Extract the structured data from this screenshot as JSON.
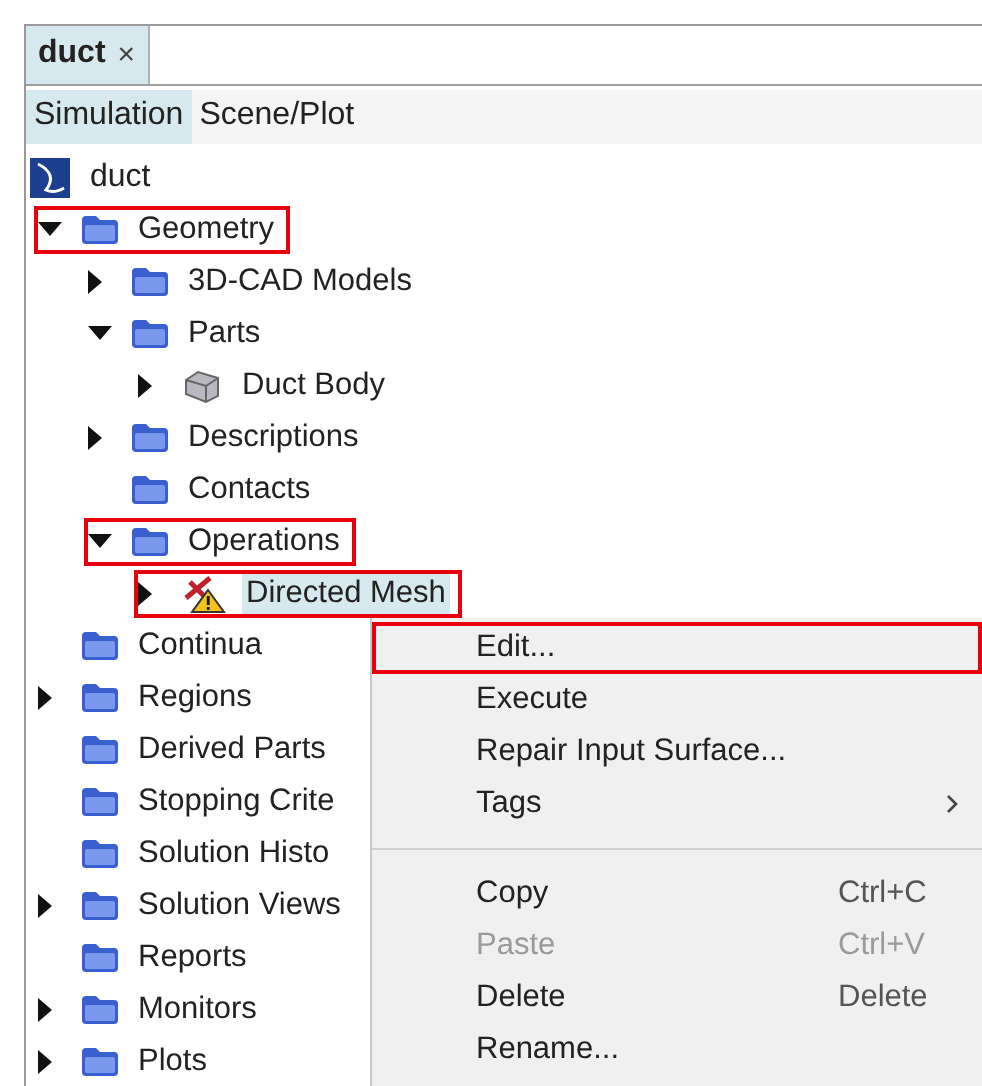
{
  "tab": {
    "title": "duct",
    "close": "×",
    "selected": true
  },
  "view_tabs": [
    {
      "label": "Simulation",
      "selected": true
    },
    {
      "label": "Scene/Plot",
      "selected": false
    }
  ],
  "tree": {
    "root": {
      "label": "duct",
      "kind": "root"
    },
    "items": [
      {
        "label": "Geometry",
        "kind": "folder",
        "expandable": true,
        "expanded": true,
        "highlighted": true,
        "selected": false,
        "children": [
          {
            "label": "3D-CAD Models",
            "kind": "folder",
            "expandable": true,
            "expanded": false,
            "highlighted": false,
            "selected": false
          },
          {
            "label": "Parts",
            "kind": "folder",
            "expandable": true,
            "expanded": true,
            "highlighted": false,
            "selected": false,
            "children": [
              {
                "label": "Duct Body",
                "kind": "part",
                "expandable": true,
                "expanded": false,
                "highlighted": false,
                "selected": false
              }
            ]
          },
          {
            "label": "Descriptions",
            "kind": "folder",
            "expandable": true,
            "expanded": false,
            "highlighted": false,
            "selected": false
          },
          {
            "label": "Contacts",
            "kind": "folder",
            "expandable": false,
            "highlighted": false,
            "selected": false
          },
          {
            "label": "Operations",
            "kind": "folder",
            "expandable": true,
            "expanded": true,
            "highlighted": true,
            "selected": false,
            "children": [
              {
                "label": "Directed Mesh",
                "kind": "operation",
                "expandable": true,
                "expanded": false,
                "highlighted": true,
                "selected": true
              }
            ]
          }
        ]
      },
      {
        "label": "Continua",
        "kind": "folder",
        "expandable": false,
        "highlighted": false,
        "selected": false
      },
      {
        "label": "Regions",
        "kind": "folder",
        "expandable": true,
        "expanded": false,
        "highlighted": false,
        "selected": false
      },
      {
        "label": "Derived Parts",
        "kind": "folder",
        "expandable": false,
        "highlighted": false,
        "selected": false
      },
      {
        "label": "Stopping Crite",
        "kind": "folder",
        "expandable": false,
        "highlighted": false,
        "selected": false
      },
      {
        "label": "Solution Histo",
        "kind": "folder",
        "expandable": false,
        "highlighted": false,
        "selected": false
      },
      {
        "label": "Solution Views",
        "kind": "folder",
        "expandable": true,
        "expanded": false,
        "highlighted": false,
        "selected": false
      },
      {
        "label": "Reports",
        "kind": "folder",
        "expandable": false,
        "highlighted": false,
        "selected": false
      },
      {
        "label": "Monitors",
        "kind": "folder",
        "expandable": true,
        "expanded": false,
        "highlighted": false,
        "selected": false
      },
      {
        "label": "Plots",
        "kind": "folder",
        "expandable": true,
        "expanded": false,
        "highlighted": false,
        "selected": false
      }
    ]
  },
  "context_menu": [
    {
      "kind": "item",
      "label": "Edit...",
      "highlighted": true,
      "disabled": false
    },
    {
      "kind": "item",
      "label": "Execute",
      "highlighted": false,
      "disabled": false
    },
    {
      "kind": "item",
      "label": "Repair Input Surface...",
      "highlighted": false,
      "disabled": false
    },
    {
      "kind": "submenu",
      "label": "Tags",
      "highlighted": false,
      "disabled": false
    },
    {
      "kind": "separator"
    },
    {
      "kind": "item",
      "label": "Copy",
      "shortcut": "Ctrl+C",
      "highlighted": false,
      "disabled": false
    },
    {
      "kind": "item",
      "label": "Paste",
      "shortcut": "Ctrl+V",
      "highlighted": false,
      "disabled": true
    },
    {
      "kind": "item",
      "label": "Delete",
      "shortcut": "Delete",
      "highlighted": false,
      "disabled": false
    },
    {
      "kind": "item",
      "label": "Rename...",
      "highlighted": false,
      "disabled": false
    }
  ]
}
